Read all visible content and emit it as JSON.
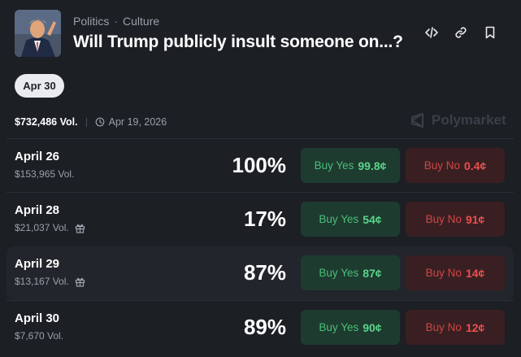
{
  "header": {
    "category": "Politics",
    "subcategory": "Culture",
    "title": "Will Trump publicly insult someone on...?",
    "icons": [
      "code-embed-icon",
      "link-icon",
      "bookmark-icon"
    ]
  },
  "date_chip": "Apr 30",
  "stats": {
    "volume": "$732,486 Vol.",
    "end_date": "Apr 19, 2026",
    "brand": "Polymarket"
  },
  "rows": [
    {
      "label": "April 26",
      "volume": "$153,965 Vol.",
      "gift": false,
      "percent": "100%",
      "yes_label": "Buy Yes",
      "yes_price": "99.8¢",
      "no_label": "Buy No",
      "no_price": "0.4¢"
    },
    {
      "label": "April 28",
      "volume": "$21,037 Vol.",
      "gift": true,
      "percent": "17%",
      "yes_label": "Buy Yes",
      "yes_price": "54¢",
      "no_label": "Buy No",
      "no_price": "91¢"
    },
    {
      "label": "April 29",
      "volume": "$13,167 Vol.",
      "gift": true,
      "percent": "87%",
      "yes_label": "Buy Yes",
      "yes_price": "87¢",
      "no_label": "Buy No",
      "no_price": "14¢"
    },
    {
      "label": "April 30",
      "volume": "$7,670 Vol.",
      "gift": false,
      "percent": "89%",
      "yes_label": "Buy Yes",
      "yes_price": "90¢",
      "no_label": "Buy No",
      "no_price": "12¢"
    }
  ],
  "colors": {
    "background": "#1c1f24",
    "yes": "#4bbf7a",
    "no": "#d14545"
  }
}
